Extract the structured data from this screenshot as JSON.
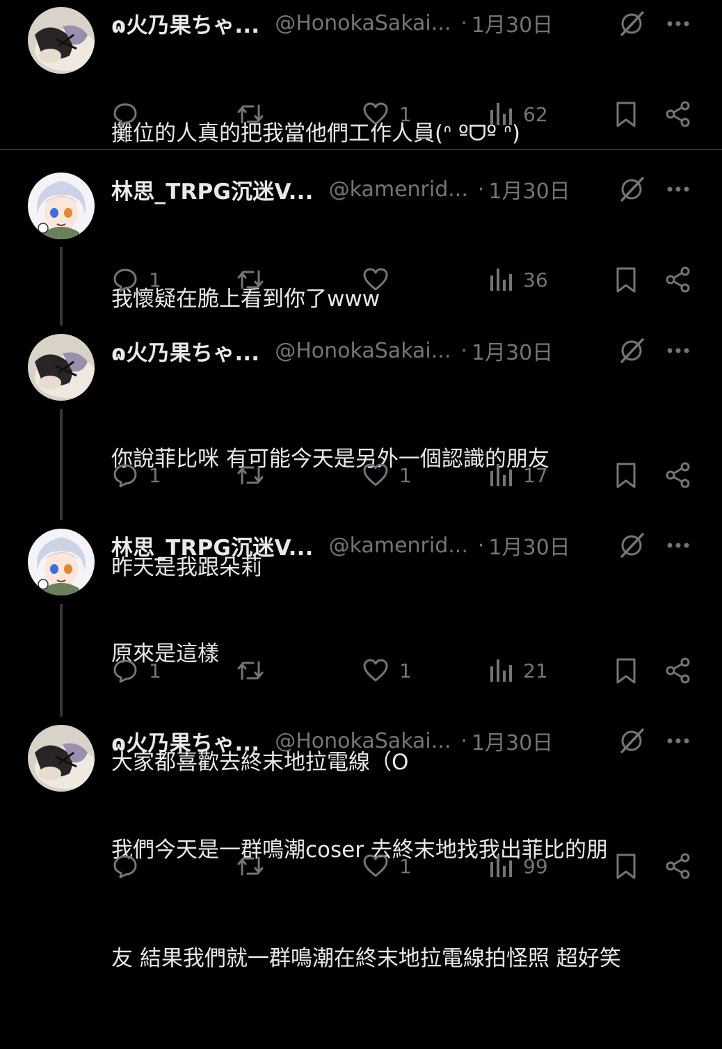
{
  "posts": [
    {
      "avatar": "cosplay-photo",
      "name": "ɷ火乃果ちゃ...",
      "handle": "@HonokaSakai...",
      "sep": "·",
      "date": "1月30日",
      "lines": [
        "攤位的人真的把我當他們工作人員(ᐢ ºᗜº ᐢ)"
      ],
      "replies": "",
      "likes": "1",
      "views": "62"
    },
    {
      "avatar": "anime-character",
      "name": "林思_TRPG沉迷V...",
      "handle": "@kamenrid...",
      "sep": "·",
      "date": "1月30日",
      "lines": [
        "我懷疑在脆上看到你了www"
      ],
      "replies": "1",
      "likes": "",
      "views": "36"
    },
    {
      "avatar": "cosplay-photo",
      "name": "ɷ火乃果ちゃ...",
      "handle": "@HonokaSakai...",
      "sep": "·",
      "date": "1月30日",
      "lines": [
        "你說菲比咪 有可能今天是另外一個認識的朋友",
        "昨天是我跟朵莉"
      ],
      "replies": "1",
      "likes": "1",
      "views": "17"
    },
    {
      "avatar": "anime-character",
      "name": "林思_TRPG沉迷V...",
      "handle": "@kamenrid...",
      "sep": "·",
      "date": "1月30日",
      "lines": [
        "原來是這樣",
        "大家都喜歡去終末地拉電線（O"
      ],
      "replies": "1",
      "likes": "1",
      "views": "21"
    },
    {
      "avatar": "cosplay-photo",
      "name": "ɷ火乃果ちゃ...",
      "handle": "@HonokaSakai...",
      "sep": "·",
      "date": "1月30日",
      "lines": [
        "我們今天是一群鳴潮coser 去終末地找我出菲比的朋",
        "友 結果我們就一群鳴潮在終末地拉電線拍怪照 超好笑"
      ],
      "replies": "",
      "likes": "1",
      "views": "99"
    }
  ],
  "colors": {
    "background": "#000000",
    "text": "#e7e9ea",
    "muted": "#71767b",
    "thread_line": "#333639"
  }
}
